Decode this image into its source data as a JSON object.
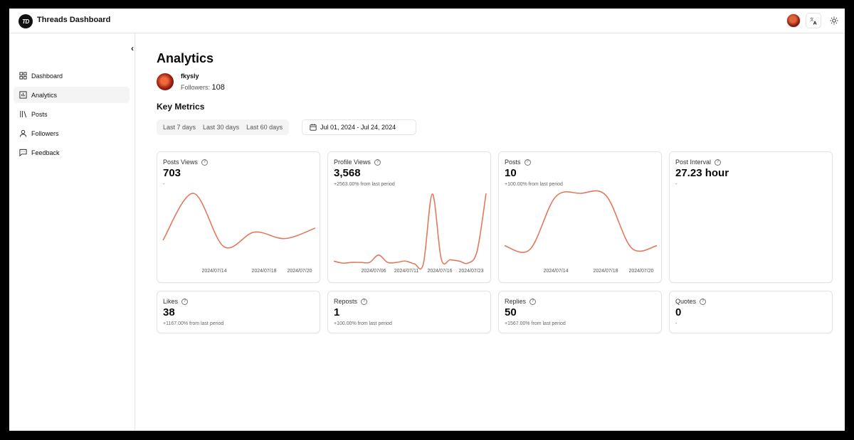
{
  "app": {
    "logo_text": "TD",
    "title": "Threads Dashboard"
  },
  "topbar": {
    "translate_icon": "translate-icon",
    "theme_icon": "sun-icon"
  },
  "sidebar": {
    "collapse_icon": "chevron-left-icon",
    "items": [
      {
        "label": "Dashboard",
        "icon": "grid-icon",
        "active": false
      },
      {
        "label": "Analytics",
        "icon": "bar-chart-icon",
        "active": true
      },
      {
        "label": "Posts",
        "icon": "library-icon",
        "active": false
      },
      {
        "label": "Followers",
        "icon": "user-icon",
        "active": false
      },
      {
        "label": "Feedback",
        "icon": "message-icon",
        "active": false
      }
    ]
  },
  "page": {
    "title": "Analytics",
    "username": "fkysly",
    "followers_label": "Followers:",
    "followers_count": "108",
    "section_title": "Key Metrics",
    "ranges": [
      "Last 7 days",
      "Last 30 days",
      "Last 60 days"
    ],
    "date_range": "Jul 01, 2024 - Jul 24, 2024"
  },
  "accent_color": "#e07a5f",
  "cards": {
    "posts_views": {
      "title": "Posts Views",
      "value": "703",
      "change": "-"
    },
    "profile_views": {
      "title": "Profile Views",
      "value": "3,568",
      "change": "+2563.00% from last period"
    },
    "posts": {
      "title": "Posts",
      "value": "10",
      "change": "+100.00% from last period"
    },
    "post_interval": {
      "title": "Post Interval",
      "value": "27.23 hour",
      "change": "-"
    },
    "likes": {
      "title": "Likes",
      "value": "38",
      "change": "+1167.00% from last period"
    },
    "reposts": {
      "title": "Reposts",
      "value": "1",
      "change": "+100.00% from last period"
    },
    "replies": {
      "title": "Replies",
      "value": "50",
      "change": "+1567.00% from last period"
    },
    "quotes": {
      "title": "Quotes",
      "value": "0",
      "change": "-"
    }
  },
  "chart_data": [
    {
      "type": "line",
      "title": "Posts Views",
      "x_ticks": [
        "2024/07/14",
        "2024/07/18",
        "2024/07/20"
      ],
      "series": [
        {
          "values": [
            30,
            88,
            22,
            40,
            32,
            45
          ]
        }
      ]
    },
    {
      "type": "line",
      "title": "Profile Views",
      "x_ticks": [
        "2024/07/06",
        "2024/07/11",
        "2024/07/16",
        "2024/07/23"
      ],
      "series": [
        {
          "values": [
            5,
            2,
            3,
            3,
            3,
            14,
            3,
            3,
            5,
            1,
            1,
            105,
            8,
            7,
            5,
            2,
            20,
            106
          ]
        }
      ]
    },
    {
      "type": "line",
      "title": "Posts",
      "x_ticks": [
        "2024/07/14",
        "2024/07/18",
        "2024/07/20"
      ],
      "series": [
        {
          "values": [
            25,
            20,
            90,
            95,
            92,
            22,
            25
          ]
        }
      ]
    }
  ]
}
